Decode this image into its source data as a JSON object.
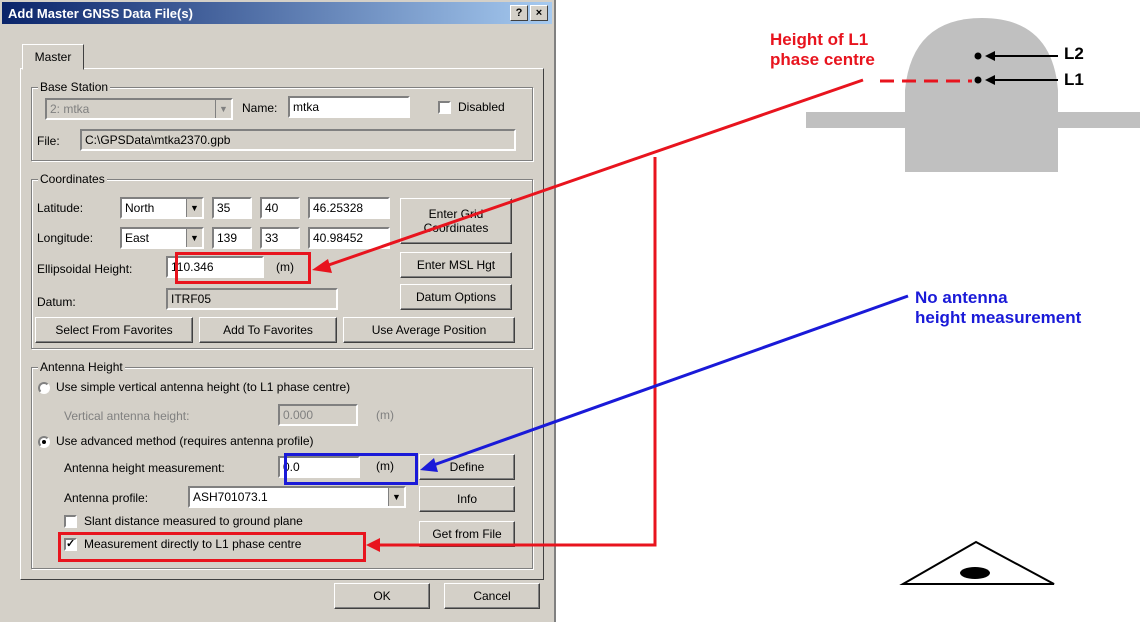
{
  "dialog": {
    "title": "Add Master GNSS Data File(s)",
    "help_btn": "?",
    "close_btn": "×",
    "tab": "Master",
    "base_station": {
      "legend": "Base Station",
      "station_value": "2: mtka",
      "name_label": "Name:",
      "name_value": "mtka",
      "disabled_label": "Disabled",
      "disabled_checked": false,
      "file_label": "File:",
      "file_value": "C:\\GPSData\\mtka2370.gpb"
    },
    "coordinates": {
      "legend": "Coordinates",
      "latitude_label": "Latitude:",
      "latitude_hemi": "North",
      "latitude_deg": "35",
      "latitude_min": "40",
      "latitude_sec": "46.25328",
      "longitude_label": "Longitude:",
      "longitude_hemi": "East",
      "longitude_deg": "139",
      "longitude_min": "33",
      "longitude_sec": "40.98452",
      "ellipsoidal_label": "Ellipsoidal Height:",
      "ellipsoidal_value": "110.346",
      "ellipsoidal_unit": "(m)",
      "datum_label": "Datum:",
      "datum_value": "ITRF05",
      "enter_grid_btn": "Enter Grid Coordinates",
      "enter_msl_btn": "Enter MSL Hgt",
      "datum_options_btn": "Datum Options",
      "select_favorites_btn": "Select From Favorites",
      "add_favorites_btn": "Add To Favorites",
      "use_average_btn": "Use Average Position"
    },
    "antenna": {
      "legend": "Antenna Height",
      "simple_label": "Use simple vertical antenna height (to L1 phase centre)",
      "simple_selected": false,
      "vertical_label": "Vertical antenna height:",
      "vertical_value": "0.000",
      "vertical_unit": "(m)",
      "advanced_label": "Use advanced method (requires antenna profile)",
      "advanced_selected": true,
      "measurement_label": "Antenna height measurement:",
      "measurement_value": "0.0",
      "measurement_unit": "(m)",
      "profile_label": "Antenna profile:",
      "profile_value": "ASH701073.1",
      "slant_label": "Slant distance measured to ground plane",
      "slant_checked": false,
      "direct_label": "Measurement directly to L1 phase centre",
      "direct_checked": true,
      "define_btn": "Define",
      "info_btn": "Info",
      "get_file_btn": "Get from File"
    },
    "ok_btn": "OK",
    "cancel_btn": "Cancel"
  },
  "annotations": {
    "height_l1_line1": "Height of L1",
    "height_l1_line2": "phase centre",
    "height_l1_color": "#e8141e",
    "no_antenna_line1": "No antenna",
    "no_antenna_line2": "height measurement",
    "no_antenna_color": "#1a1ad8",
    "l2_label": "L2",
    "l1_label": "L1"
  }
}
